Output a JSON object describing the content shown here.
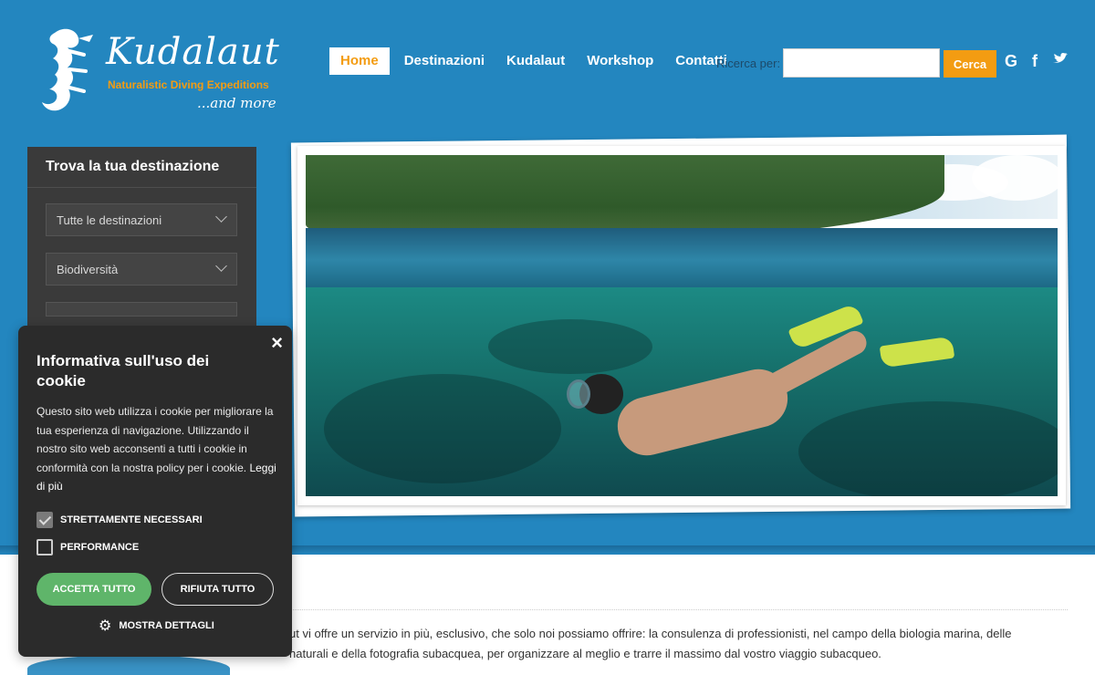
{
  "logo": {
    "wordmark": "Kudalaut",
    "tagline": "Naturalistic Diving Expeditions",
    "more": "...and more"
  },
  "nav": {
    "items": [
      {
        "label": "Home",
        "active": true
      },
      {
        "label": "Destinazioni",
        "active": false
      },
      {
        "label": "Kudalaut",
        "active": false
      },
      {
        "label": "Workshop",
        "active": false
      },
      {
        "label": "Contatti",
        "active": false
      }
    ]
  },
  "search": {
    "label": "Ricerca per:",
    "value": "",
    "button": "Cerca"
  },
  "social": [
    "google-plus-icon",
    "facebook-icon",
    "twitter-icon"
  ],
  "sidebar": {
    "title": "Trova la tua destinazione",
    "selects": [
      "Tutte le destinazioni",
      "Biodiversità"
    ]
  },
  "content": {
    "text_line1": "ut vi offre un servizio in  più, esclusivo, che solo noi possiamo offrire: la consulenza di professionisti, nel campo della biologia marina, delle",
    "text_line2": "naturali e della fotografia subacquea, per organizzare al meglio e trarre il massimo dal vostro viaggio subacqueo."
  },
  "cookie": {
    "title": "Informativa sull'uso dei cookie",
    "text": "Questo sito web utilizza i cookie per migliorare la tua esperienza di navigazione. Utilizzando il nostro sito web acconsenti a tutti i cookie in conformità con la nostra policy per i cookie.",
    "more_link": "Leggi di più",
    "options": [
      {
        "label": "STRETTAMENTE NECESSARI",
        "checked": true
      },
      {
        "label": "PERFORMANCE",
        "checked": false
      }
    ],
    "accept": "ACCETTA TUTTO",
    "reject": "RIFIUTA TUTTO",
    "details": "MOSTRA DETTAGLI",
    "close": "×"
  },
  "colors": {
    "brand_blue": "#2386bf",
    "accent_orange": "#f39c12",
    "accept_green": "#5fb56a",
    "dark_panel": "#2b2b2b"
  }
}
